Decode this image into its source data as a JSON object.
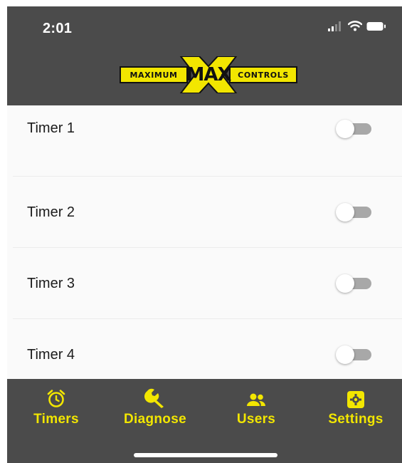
{
  "status_bar": {
    "time": "2:01",
    "icons": [
      "signal-icon",
      "wifi-icon",
      "battery-icon"
    ]
  },
  "header": {
    "logo": {
      "left_text": "MAXIMUM",
      "center_text": "MAX",
      "right_text": "CONTROLS"
    }
  },
  "timers": [
    {
      "label": "Timer 1",
      "enabled": false
    },
    {
      "label": "Timer 2",
      "enabled": false
    },
    {
      "label": "Timer 3",
      "enabled": false
    },
    {
      "label": "Timer 4",
      "enabled": false
    }
  ],
  "tabbar": {
    "tabs": [
      {
        "label": "Timers",
        "icon": "alarm-clock-icon"
      },
      {
        "label": "Diagnose",
        "icon": "wrench-icon"
      },
      {
        "label": "Users",
        "icon": "users-icon"
      },
      {
        "label": "Settings",
        "icon": "gear-icon"
      }
    ]
  },
  "colors": {
    "header_bg": "#4b4b4b",
    "accent_yellow": "#f2e600",
    "list_bg": "#fafafa",
    "toggle_off_track": "#a8a8a8"
  }
}
